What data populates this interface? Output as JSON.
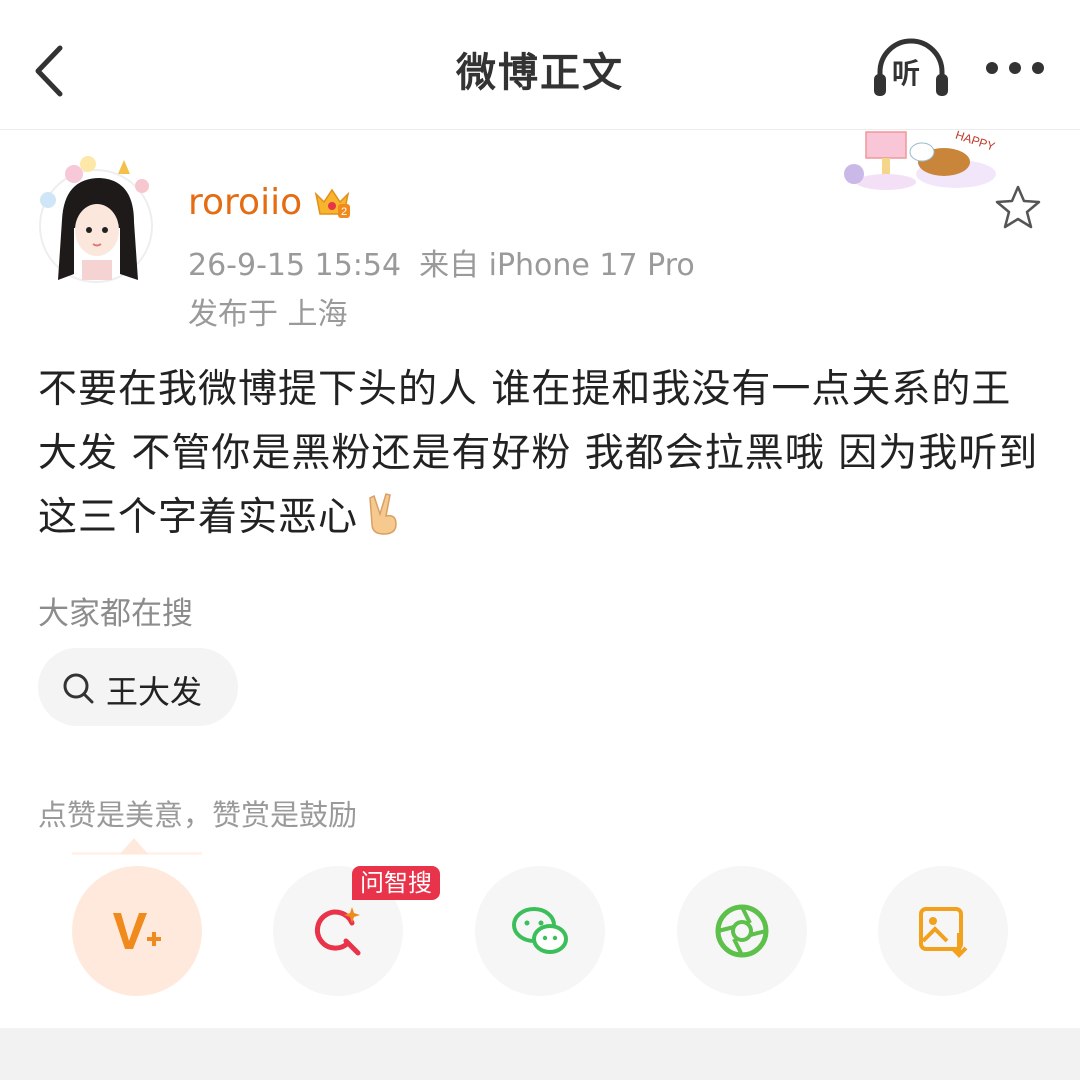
{
  "header": {
    "title": "微博正文",
    "listen_label": "听"
  },
  "user": {
    "name": "roroiio",
    "level_badge": "2",
    "time": "26-9-15 15:54",
    "source": "来自 iPhone 17 Pro",
    "location": "发布于 上海",
    "sticker_text": "HAPPY"
  },
  "post": {
    "text": "不要在我微博提下头的人 谁在提和我没有一点关系的王大发 不管你是黑粉还是有好粉 我都会拉黑哦 因为我听到这三个字着实恶心"
  },
  "search": {
    "heading": "大家都在搜",
    "chip_label": "王大发"
  },
  "encourage": {
    "text": "点赞是美意，赞赏是鼓励"
  },
  "actions": {
    "ai_badge": "问智搜",
    "icons": [
      "v-plus-icon",
      "ai-search-icon",
      "wechat-icon",
      "moments-icon",
      "save-image-icon"
    ]
  },
  "colors": {
    "username": "#e46c12",
    "accent_orange": "#f08a1c",
    "ai_red": "#e8334a",
    "wechat_green": "#3cbf5a",
    "moments_green": "#5cc04a",
    "save_orange": "#f2a11c"
  }
}
